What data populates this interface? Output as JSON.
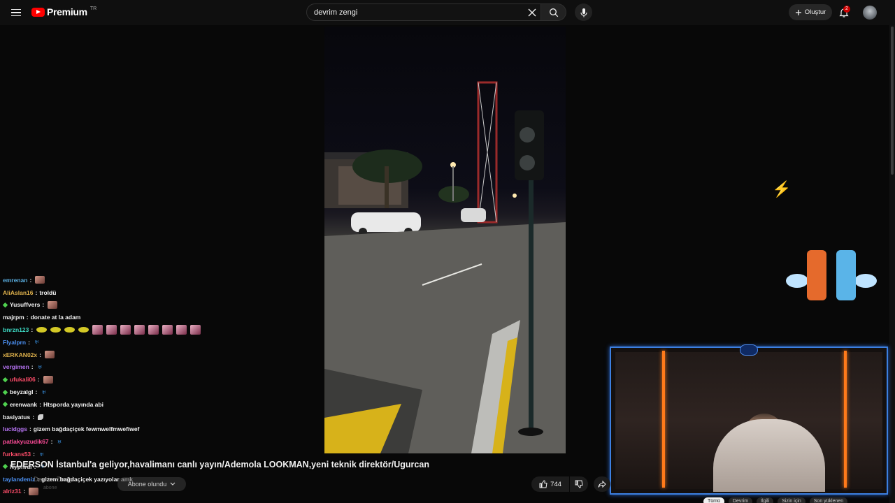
{
  "header": {
    "brand": "Premium",
    "region": "TR",
    "search_value": "devrim zengi",
    "create_label": "Oluştur",
    "notifications_count": "2"
  },
  "chat": [
    {
      "user": "emrenan",
      "color": "#5aaee0",
      "badge": false,
      "msg": "",
      "emotes": [
        "emote"
      ]
    },
    {
      "user": "AliAslan16",
      "color": "#e0b24c",
      "badge": false,
      "msg": "troldü",
      "emotes": []
    },
    {
      "user": "Yusuffvers",
      "color": "#f2f2f2",
      "badge": true,
      "msg": "",
      "emotes": [
        "emote"
      ]
    },
    {
      "user": "majrpm",
      "color": "#f2f2f2",
      "badge": false,
      "msg": "donate at la adam",
      "emotes": []
    },
    {
      "user": "bnrzn123",
      "color": "#3dd8c2",
      "badge": false,
      "msg": "",
      "emotes": [
        "yellow",
        "yellow",
        "yellow",
        "yellow",
        "face",
        "face",
        "face",
        "face",
        "face",
        "face",
        "face",
        "face"
      ]
    },
    {
      "user": "Flyalprn",
      "color": "#4b8ff0",
      "badge": false,
      "msg": "",
      "emotes": [
        "blue"
      ]
    },
    {
      "user": "xERKAN02x",
      "color": "#e0b24c",
      "badge": false,
      "msg": "",
      "emotes": [
        "emote"
      ]
    },
    {
      "user": "vergimen",
      "color": "#b472f0",
      "badge": false,
      "msg": "",
      "emotes": [
        "blue"
      ]
    },
    {
      "user": "ufukali06",
      "color": "#ff4d6a",
      "badge": true,
      "msg": "",
      "emotes": [
        "emote"
      ]
    },
    {
      "user": "beyzalgl",
      "color": "#f2f2f2",
      "badge": true,
      "msg": "",
      "emotes": [
        "blue"
      ]
    },
    {
      "user": "erenwank",
      "color": "#f2f2f2",
      "badge": true,
      "msg": "Htsporda yayında abi",
      "emotes": []
    },
    {
      "user": "basiyatus",
      "color": "#f2f2f2",
      "badge": false,
      "msg": "",
      "emotes": [
        "leaf"
      ]
    },
    {
      "user": "lucidggs",
      "color": "#b472f0",
      "badge": false,
      "msg": "gizem bağdaçiçek fewmwelfmwefiwef",
      "emotes": []
    },
    {
      "user": "patlakyuzudik67",
      "color": "#ff4d9a",
      "badge": false,
      "msg": "",
      "emotes": [
        "blue"
      ]
    },
    {
      "user": "furkans53",
      "color": "#ff4d6a",
      "badge": false,
      "msg": "",
      "emotes": [
        "blue"
      ]
    },
    {
      "user": "Nyphral",
      "color": "#f2f2f2",
      "badge": true,
      "msg": "",
      "emotes": [
        "blue"
      ]
    },
    {
      "user": "taylandeniz",
      "color": "#4b8ff0",
      "badge": false,
      "msg": "gizem bağdaçiçek yazıyolar amk",
      "emotes": []
    },
    {
      "user": "alriz31",
      "color": "#ff4d6a",
      "badge": false,
      "msg": "",
      "emotes": [
        "emote"
      ]
    }
  ],
  "video": {
    "title": "EDERSON İstanbul'a geliyor,havalimanı canlı yayın/Ademola LOOKMAN,yeni teknik direktör/Ugurcan",
    "channel": "Devrim Zengi",
    "subscribers": "abone",
    "subscribed_label": "Abone olundu",
    "likes": "744"
  },
  "bottom_tabs": [
    "Tümü",
    "Devrim",
    "İlgili",
    "Sizin için",
    "Son yüklenen"
  ],
  "icons": {
    "menu": "menu-icon",
    "search": "search-icon",
    "clear": "close-icon",
    "mic": "mic-icon",
    "bell": "bell-icon",
    "like": "thumbs-up-icon",
    "dislike": "thumbs-down-icon",
    "share": "share-icon"
  },
  "colors": {
    "accent": "#ff0000",
    "cam_border": "#3c7fe0",
    "neon": "#ff7a1a"
  }
}
